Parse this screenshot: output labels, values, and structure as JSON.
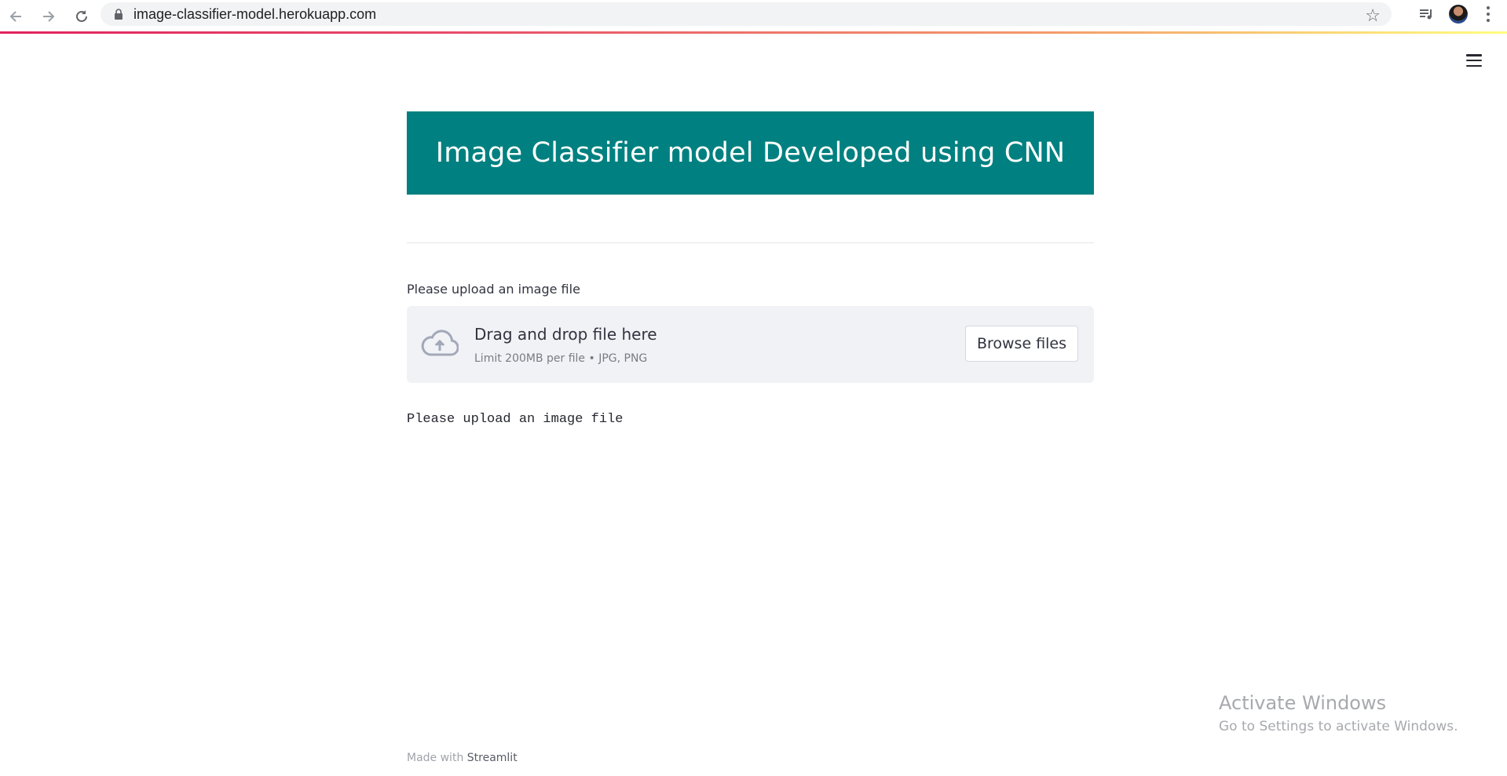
{
  "browser": {
    "url": "image-classifier-model.herokuapp.com"
  },
  "app": {
    "title": "Image Classifier model Developed using CNN",
    "accent_color": "#008080",
    "upload": {
      "label": "Please upload an image file",
      "drop_title": "Drag and drop file here",
      "drop_limit": "Limit 200MB per file • JPG, PNG",
      "browse_label": "Browse files"
    },
    "status_text": "Please upload an image file"
  },
  "footer": {
    "made_with": "Made with",
    "brand": "Streamlit"
  },
  "watermark": {
    "title": "Activate Windows",
    "subtitle": "Go to Settings to activate Windows."
  }
}
